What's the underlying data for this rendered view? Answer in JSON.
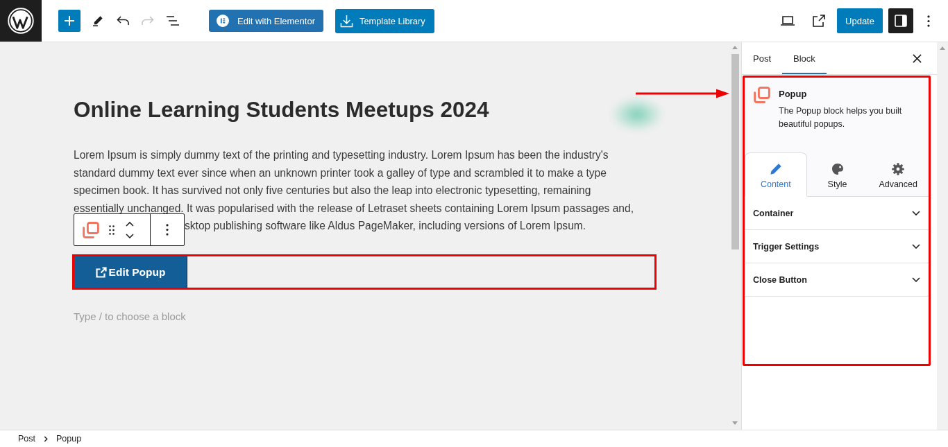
{
  "top_bar": {
    "tools": [
      {
        "kind": "add",
        "disabled": false
      },
      {
        "kind": "pencil",
        "disabled": false
      },
      {
        "kind": "undo",
        "disabled": false
      },
      {
        "kind": "redo",
        "disabled": true
      },
      {
        "kind": "list",
        "disabled": false
      }
    ],
    "actions": [
      {
        "kind": "elementor",
        "label": "Edit with Elementor"
      },
      {
        "kind": "library",
        "label": "Template Library"
      }
    ],
    "controls": [
      {
        "kind": "preview"
      },
      {
        "kind": "view"
      },
      {
        "kind": "update",
        "label": "Update"
      },
      {
        "kind": "sidebar",
        "on": true
      },
      {
        "kind": "options"
      }
    ]
  },
  "editor": {
    "title": "Online Learning Students Meetups 2024",
    "paragraph": "Lorem Ipsum is simply dummy text of the printing and typesetting industry. Lorem Ipsum has been the industry's standard dummy text ever since when an unknown printer took a galley of type and scrambled it to make a type specimen book. It has survived not only five centuries but also the leap into electronic typesetting, remaining essentially unchanged. It was popularised with the release of Letraset sheets containing Lorem Ipsum passages and,",
    "paragraph_tail": "sktop publishing software like Aldus PageMaker, including versions of Lorem Ipsum.",
    "popup_button": {
      "label": "Edit Popup"
    },
    "appender": {
      "placeholder": "Type / to choose a block"
    }
  },
  "sidebar": {
    "tabs": [
      {
        "label": "Post",
        "selected": false
      },
      {
        "label": "Block",
        "selected": true
      }
    ],
    "block": {
      "title": "Popup",
      "description": "The Popup block helps you built beautiful popups."
    },
    "inspector_tabs": [
      {
        "kind": "content",
        "label": "Content",
        "selected": true
      },
      {
        "kind": "style",
        "label": "Style",
        "selected": false
      },
      {
        "kind": "advanced",
        "label": "Advanced",
        "selected": false
      }
    ],
    "panels": [
      {
        "title": "Container",
        "expanded": false
      },
      {
        "title": "Trigger Settings",
        "expanded": false
      },
      {
        "title": "Close Button",
        "expanded": false
      }
    ]
  },
  "breadcrumb": {
    "items": [
      "Post",
      "Popup"
    ]
  }
}
